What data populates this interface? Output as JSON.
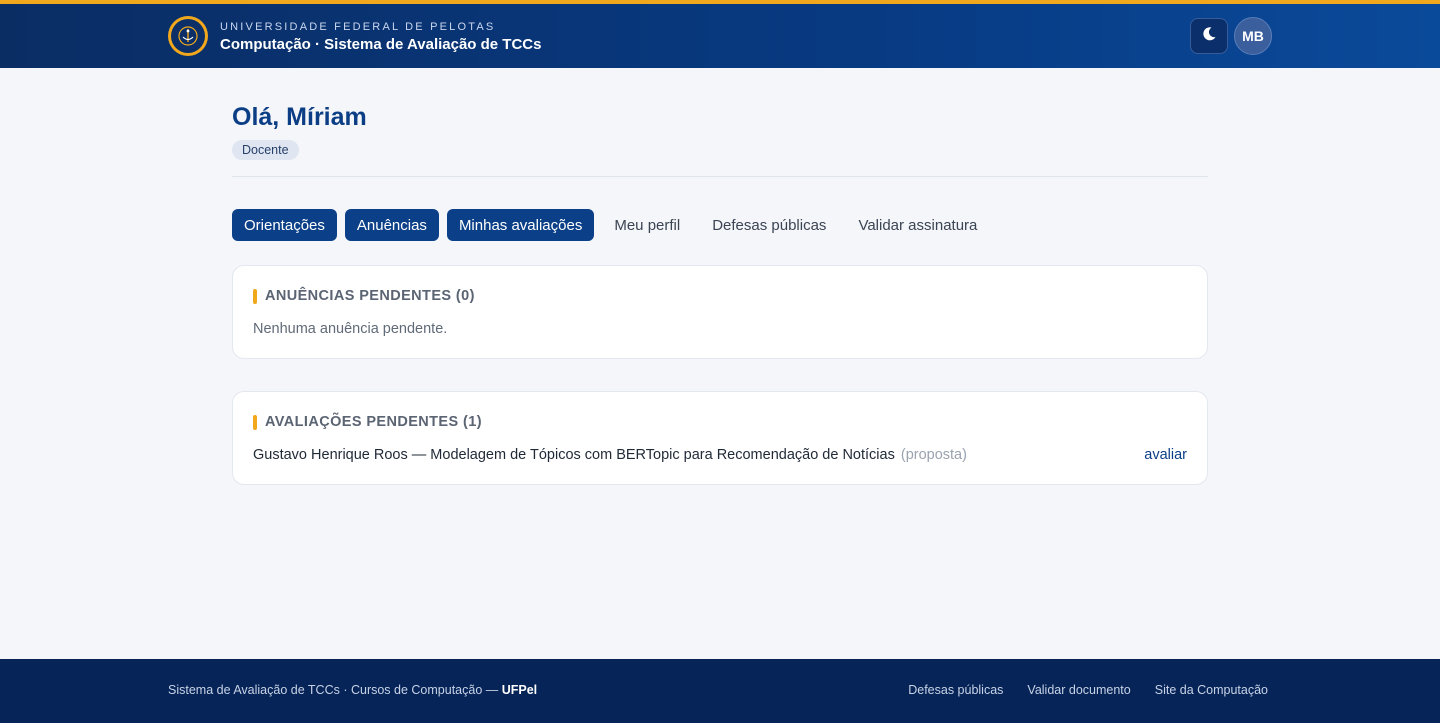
{
  "header": {
    "institution": "UNIVERSIDADE FEDERAL DE PELOTAS",
    "system_title": "Computação · Sistema de Avaliação de TCCs",
    "theme_icon": "moon-icon",
    "avatar_initials": "MB",
    "colors": {
      "bar_start": "#0a2d64",
      "bar_end": "#0a4a9a",
      "accent": "#f2a81d"
    }
  },
  "main": {
    "greeting": "Olá, Míriam",
    "role": "Docente",
    "tabs": [
      {
        "label": "Orientações",
        "active": true
      },
      {
        "label": "Anuências",
        "active": true
      },
      {
        "label": "Minhas avaliações",
        "active": true
      },
      {
        "label": "Meu perfil",
        "active": false
      },
      {
        "label": "Defesas públicas",
        "active": false
      },
      {
        "label": "Validar assinatura",
        "active": false
      }
    ],
    "anuencias": {
      "title": "ANUÊNCIAS PENDENTES (0)",
      "empty_message": "Nenhuma anuência pendente."
    },
    "avaliacoes": {
      "title": "AVALIAÇÕES PENDENTES (1)",
      "items": [
        {
          "text": "Gustavo Henrique Roos — Modelagem de Tópicos com BERTopic para Recomendação de Notícias",
          "kind": "(proposta)",
          "action": "avaliar"
        }
      ]
    }
  },
  "footer": {
    "left_text": "Sistema de Avaliação de TCCs · Cursos de Computação — ",
    "left_bold": "UFPel",
    "links": [
      "Defesas públicas",
      "Validar documento",
      "Site da Computação"
    ]
  }
}
